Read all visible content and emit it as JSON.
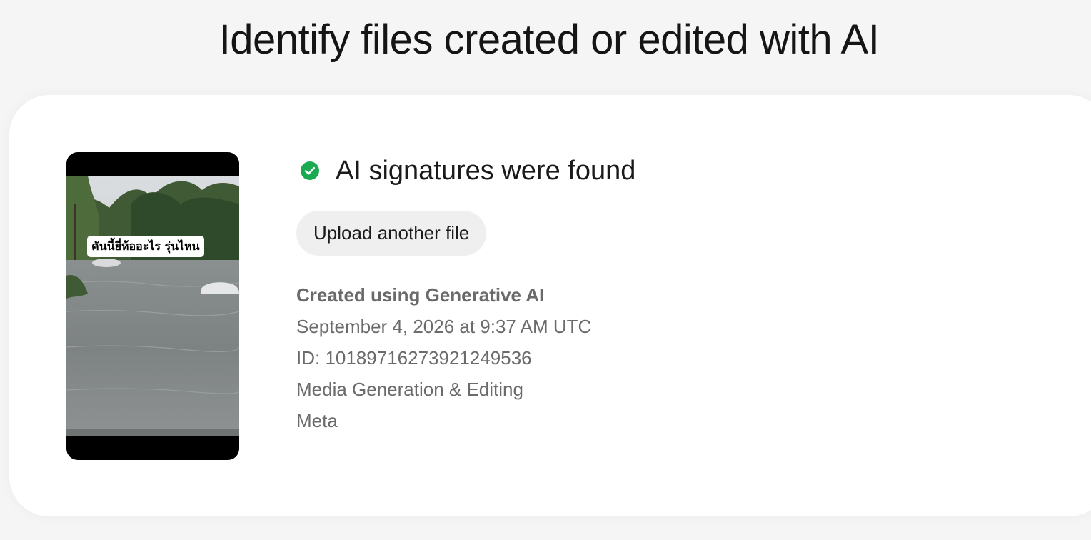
{
  "page": {
    "title": "Identify files created or edited with AI"
  },
  "result": {
    "thumbnail_caption": "คันนี้ยี่ห้ออะไร รุ่นไหน",
    "status_icon": "check-circle-icon",
    "status_color": "#1aab52",
    "status_title": "AI signatures were found",
    "upload_button_label": "Upload another file",
    "details": {
      "created_using": "Created using Generative AI",
      "date": "September 4, 2026 at 9:37 AM UTC",
      "id": "ID: 1018971627392​1249536",
      "tool": "Media Generation & Editing",
      "issuer": "Meta"
    }
  }
}
